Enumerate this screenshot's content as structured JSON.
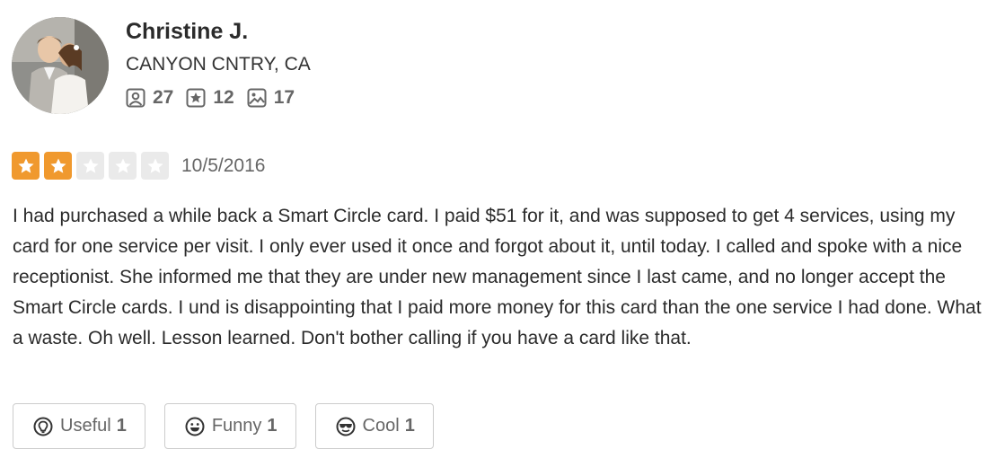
{
  "user": {
    "name": "Christine J.",
    "location": "CANYON CNTRY, CA",
    "stats": {
      "friends": "27",
      "reviews": "12",
      "photos": "17"
    }
  },
  "review": {
    "rating": 2,
    "max_rating": 5,
    "date": "10/5/2016",
    "text": "I had purchased a while back a Smart Circle card. I paid $51 for it, and was supposed to get 4 services, using my card for one service per visit. I only ever used it once and forgot about it, until today. I called and spoke with a nice receptionist. She informed me that they are under new management since I last came, and no longer accept the Smart Circle cards. I und is disappointing that I paid more money for this card than the one service I had done. What a waste. Oh well. Lesson learned. Don't bother calling if you have a card like that."
  },
  "votes": {
    "useful": {
      "label": "Useful",
      "count": "1",
      "icon": "lightbulb-icon"
    },
    "funny": {
      "label": "Funny",
      "count": "1",
      "icon": "smiley-icon"
    },
    "cool": {
      "label": "Cool",
      "count": "1",
      "icon": "sunglasses-icon"
    }
  },
  "colors": {
    "star_filled": "#f0992e",
    "star_empty": "#eaeaea",
    "text": "#333333",
    "muted": "#666666",
    "border": "#cccccc"
  }
}
